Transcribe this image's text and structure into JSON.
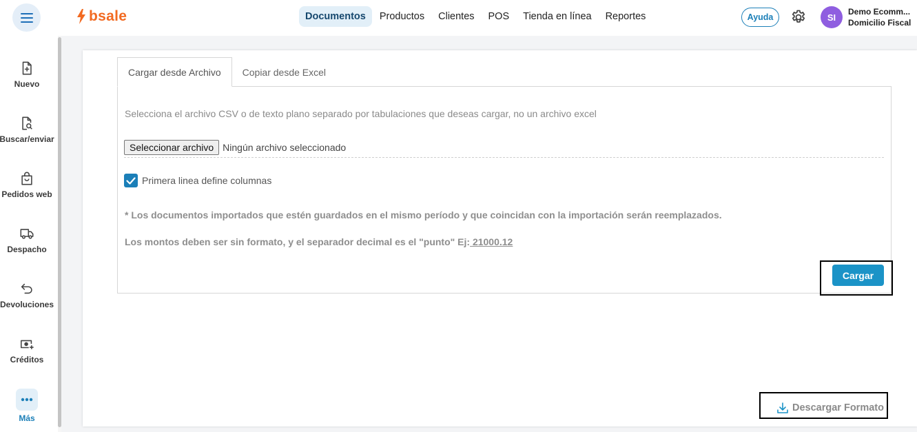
{
  "header": {
    "logo_text": "bsale",
    "nav": [
      {
        "label": "Documentos",
        "active": true
      },
      {
        "label": "Productos",
        "active": false
      },
      {
        "label": "Clientes",
        "active": false
      },
      {
        "label": "POS",
        "active": false
      },
      {
        "label": "Tienda en línea",
        "active": false
      },
      {
        "label": "Reportes",
        "active": false
      }
    ],
    "help_label": "Ayuda",
    "avatar_initials": "SI",
    "company_name": "Demo Ecomm...",
    "company_branch": "Domicilio Fiscal"
  },
  "sidebar": {
    "items": [
      {
        "label": "Nuevo",
        "icon": "file-plus-icon"
      },
      {
        "label": "Buscar/enviar",
        "icon": "file-search-icon"
      },
      {
        "label": "Pedidos web",
        "icon": "shopping-bag-icon"
      },
      {
        "label": "Despacho",
        "icon": "truck-icon"
      },
      {
        "label": "Devoluciones",
        "icon": "return-arrow-icon"
      },
      {
        "label": "Créditos",
        "icon": "cash-plus-icon"
      },
      {
        "label": "Más",
        "icon": "more-dots-icon"
      }
    ]
  },
  "import": {
    "tabs": [
      {
        "label": "Cargar desde Archivo",
        "active": true
      },
      {
        "label": "Copiar desde Excel",
        "active": false
      }
    ],
    "instruction": "Selecciona el archivo CSV o de texto plano separado por tabulaciones que deseas cargar, no un archivo excel",
    "file_button": "Seleccionar archivo",
    "file_status": "Ningún archivo seleccionado",
    "checkbox_label": "Primera linea define columnas",
    "checkbox_checked": true,
    "note_replace": "* Los documentos importados que estén guardados en el mismo período y que coincidan con la importación serán reemplazados.",
    "note_amounts_prefix": "Los montos deben ser sin formato, y el separador decimal es el \"punto\" Ej:",
    "note_amounts_example": " 21000.12",
    "submit_label": "Cargar",
    "download_label": "Descargar Formato"
  },
  "colors": {
    "brand_orange": "#f26a21",
    "accent_blue": "#1b93c7",
    "avatar_purple": "#8f5ee0"
  }
}
